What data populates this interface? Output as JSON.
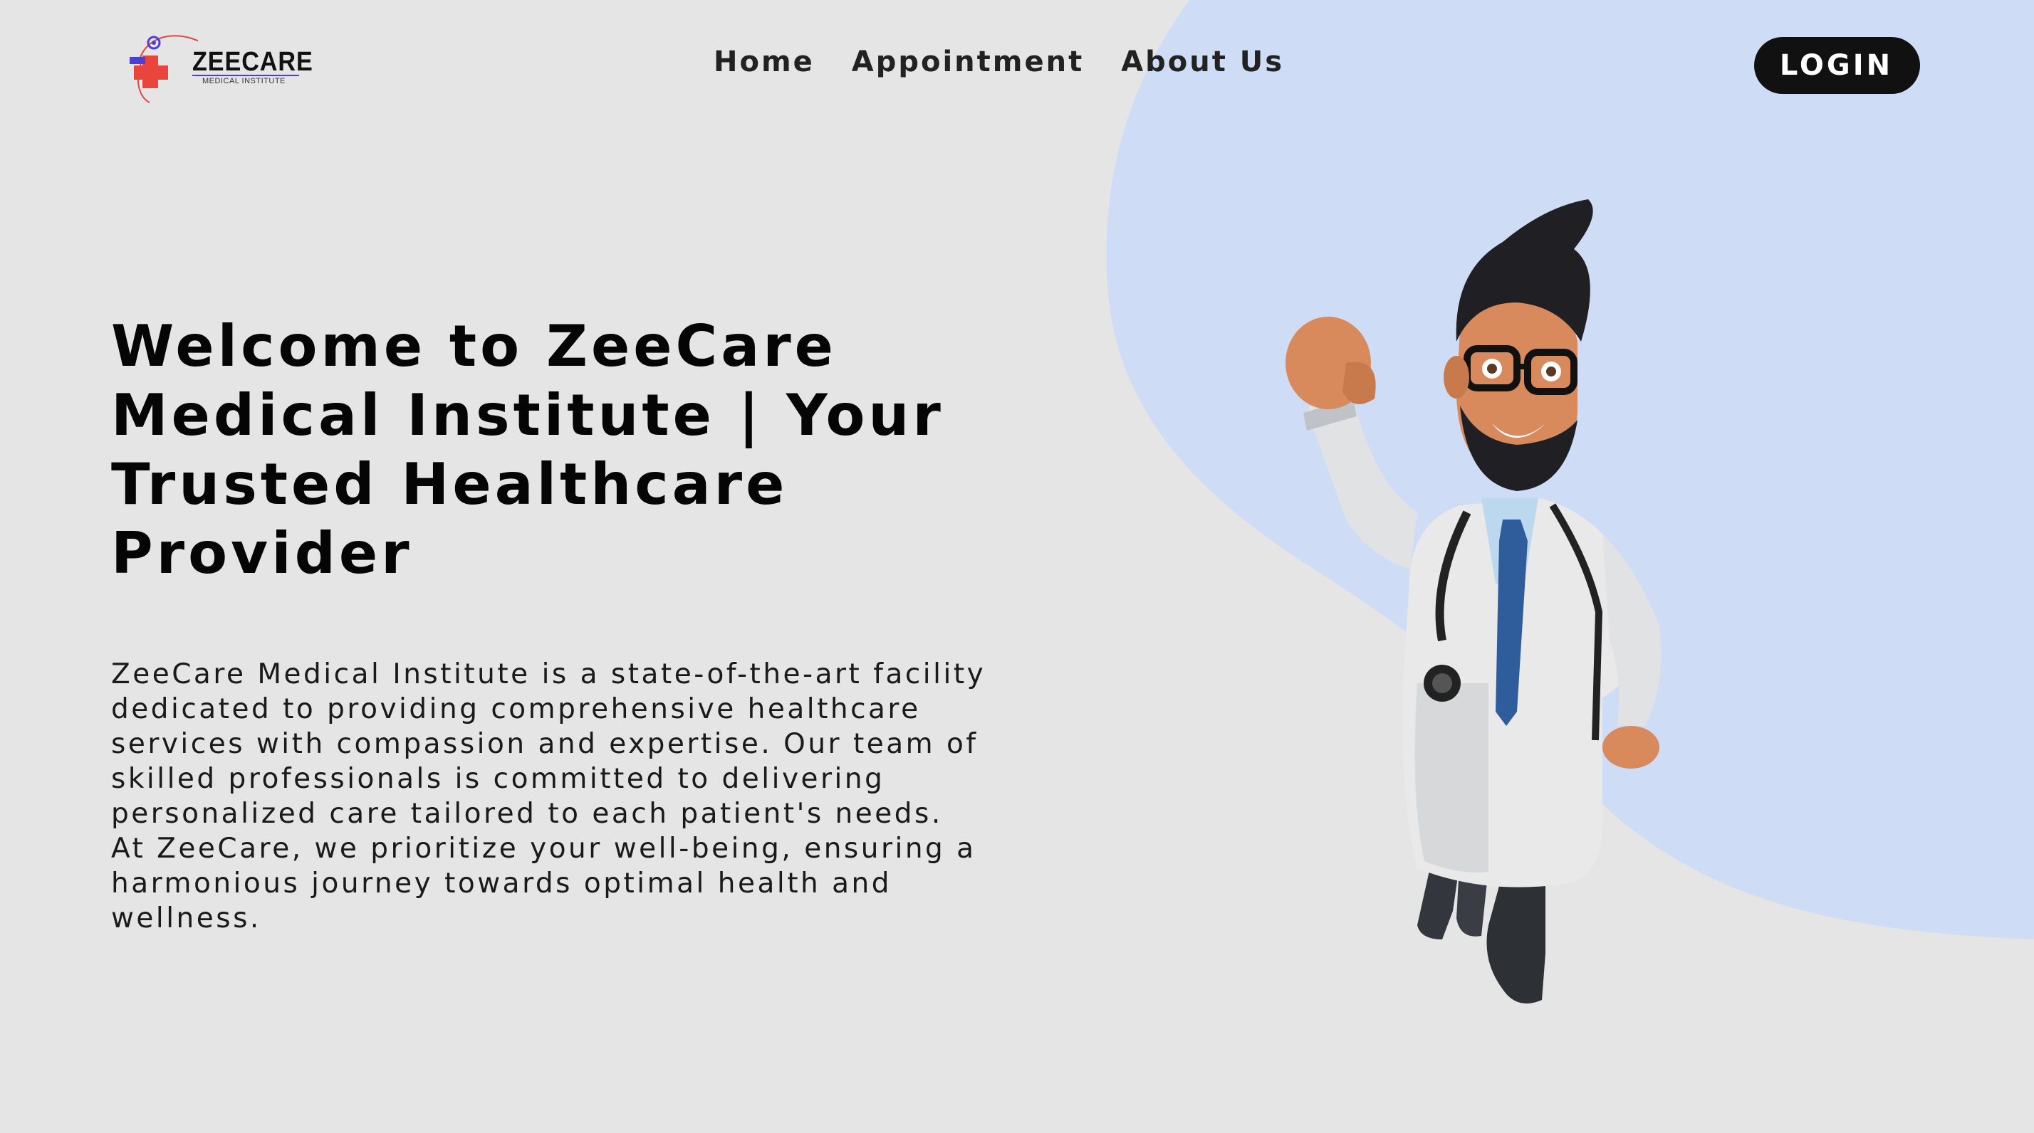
{
  "brand": {
    "name": "ZEECARE",
    "tagline": "MEDICAL INSTITUTE"
  },
  "nav": {
    "links": [
      "Home",
      "Appointment",
      "About Us"
    ],
    "login_label": "LOGIN"
  },
  "hero": {
    "title": "Welcome to ZeeCare Medical Institute | Your Trusted Healthcare Provider",
    "description": "ZeeCare Medical Institute is a state-of-the-art facility dedicated to providing comprehensive healthcare services with compassion and expertise. Our team of skilled professionals is committed to delivering personalized care tailored to each patient's needs. At ZeeCare, we prioritize your well-being, ensuring a harmonious journey towards optimal health and wellness."
  },
  "colors": {
    "background": "#e5e5e5",
    "blob": "#cfdcf6",
    "button": "#111111",
    "logo_red": "#e8453c",
    "logo_purple": "#4b3fd6"
  },
  "icons": {
    "logo": "medical-cross-logo-icon",
    "hero_image": "superhero-doctor-illustration"
  }
}
